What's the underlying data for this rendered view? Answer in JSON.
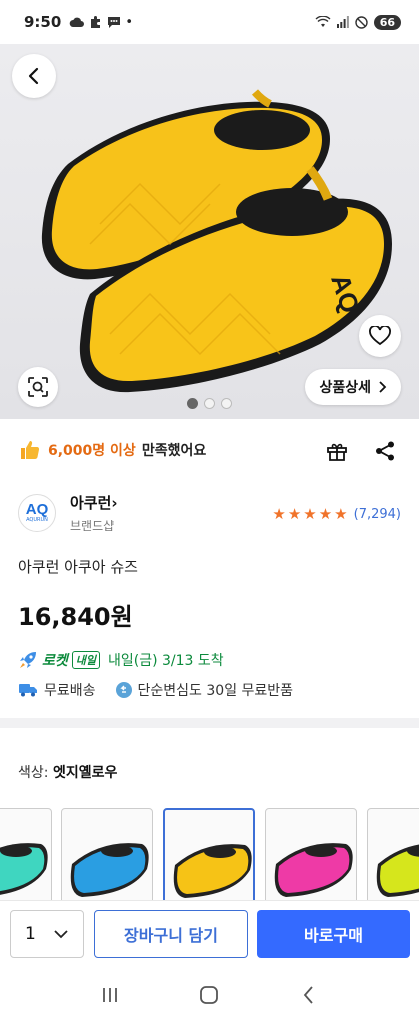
{
  "status_bar": {
    "time": "9:50",
    "dot": "•",
    "battery": "66"
  },
  "hero": {
    "detail_label": "상품상세",
    "image_count": 3,
    "active_image": 1
  },
  "satisfaction": {
    "highlight": "6,000명 이상",
    "suffix": "만족했어요"
  },
  "brand": {
    "name": "아쿠런",
    "chevron": "›",
    "shop_label": "브랜드샵",
    "logo_text": "AQ",
    "logo_sub": "AQURUN"
  },
  "rating": {
    "stars": 5,
    "count": "(7,294)"
  },
  "product": {
    "name": "아쿠런 아쿠아 슈즈",
    "price": "16,840원"
  },
  "delivery": {
    "rocket": "로켓",
    "badge": "내일",
    "date": "내일(금) 3/13 도착"
  },
  "shipping": {
    "free_shipping": "무료배송",
    "free_return": "단순변심도 30일 무료반품"
  },
  "color": {
    "label": "색상:",
    "value": "엣지옐로우"
  },
  "swatches": [
    {
      "name": "mint",
      "color": "#3fd6c0",
      "selected": false
    },
    {
      "name": "blue",
      "color": "#2a9ee2",
      "selected": false
    },
    {
      "name": "yellow",
      "color": "#f6c316",
      "selected": true
    },
    {
      "name": "pink",
      "color": "#ee3aa6",
      "selected": false
    },
    {
      "name": "lime",
      "color": "#d6e61c",
      "selected": false
    }
  ],
  "bottom_bar": {
    "quantity": "1",
    "cart_label": "장바구니 담기",
    "buy_label": "바로구매"
  },
  "colors": {
    "accent_blue": "#346aff",
    "rocket_green": "#0c8a3c",
    "orange": "#e46a12",
    "star": "#f0732a"
  }
}
